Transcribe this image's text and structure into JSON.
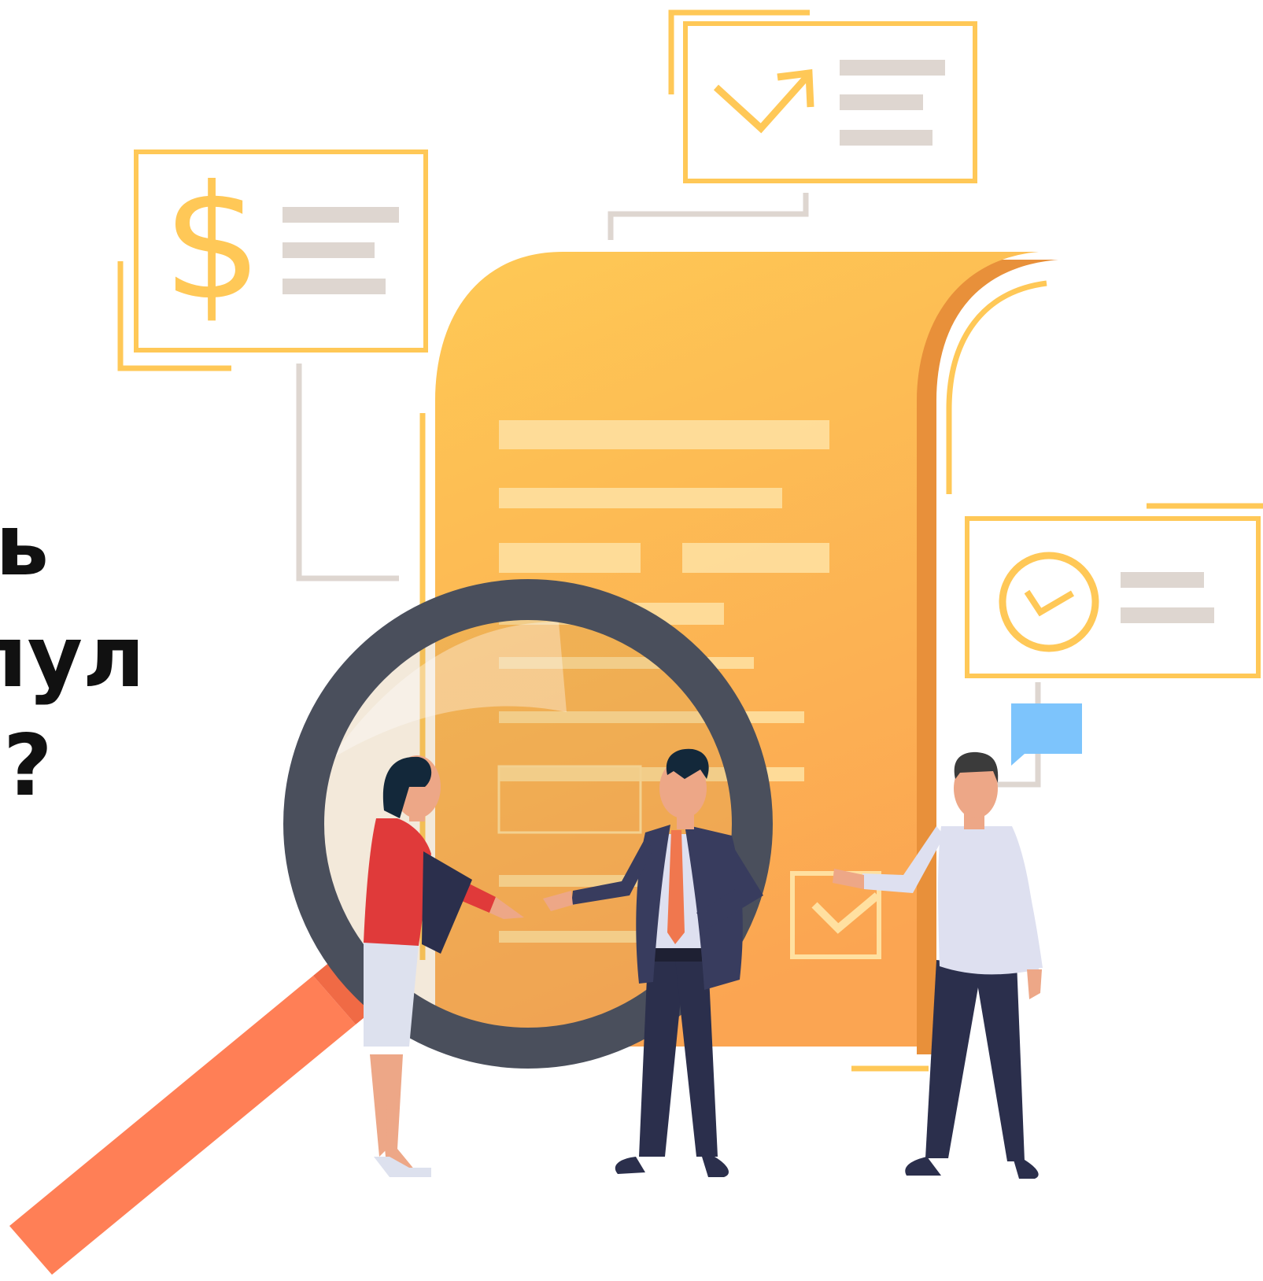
{
  "headline": {
    "line1": "ь",
    "line2": "пул",
    "line3": "?"
  },
  "colors": {
    "accent": "#FFC857",
    "accent_dark": "#E8903A",
    "document": "#FDB74C",
    "placeholder_line": "#DED6D0",
    "magnifier_frame": "#4A4F5C",
    "magnifier_handle": "#FF7F56",
    "chat_bubble": "#7DC4FC",
    "suit_navy": "#2B2F4C",
    "shirt_red": "#E03A3A",
    "shirt_light": "#DEE0F0"
  },
  "icons": [
    "dollar-icon",
    "trend-check-icon",
    "circle-check-icon",
    "checkbox-icon",
    "chat-bubble-icon",
    "magnifying-glass-icon"
  ]
}
